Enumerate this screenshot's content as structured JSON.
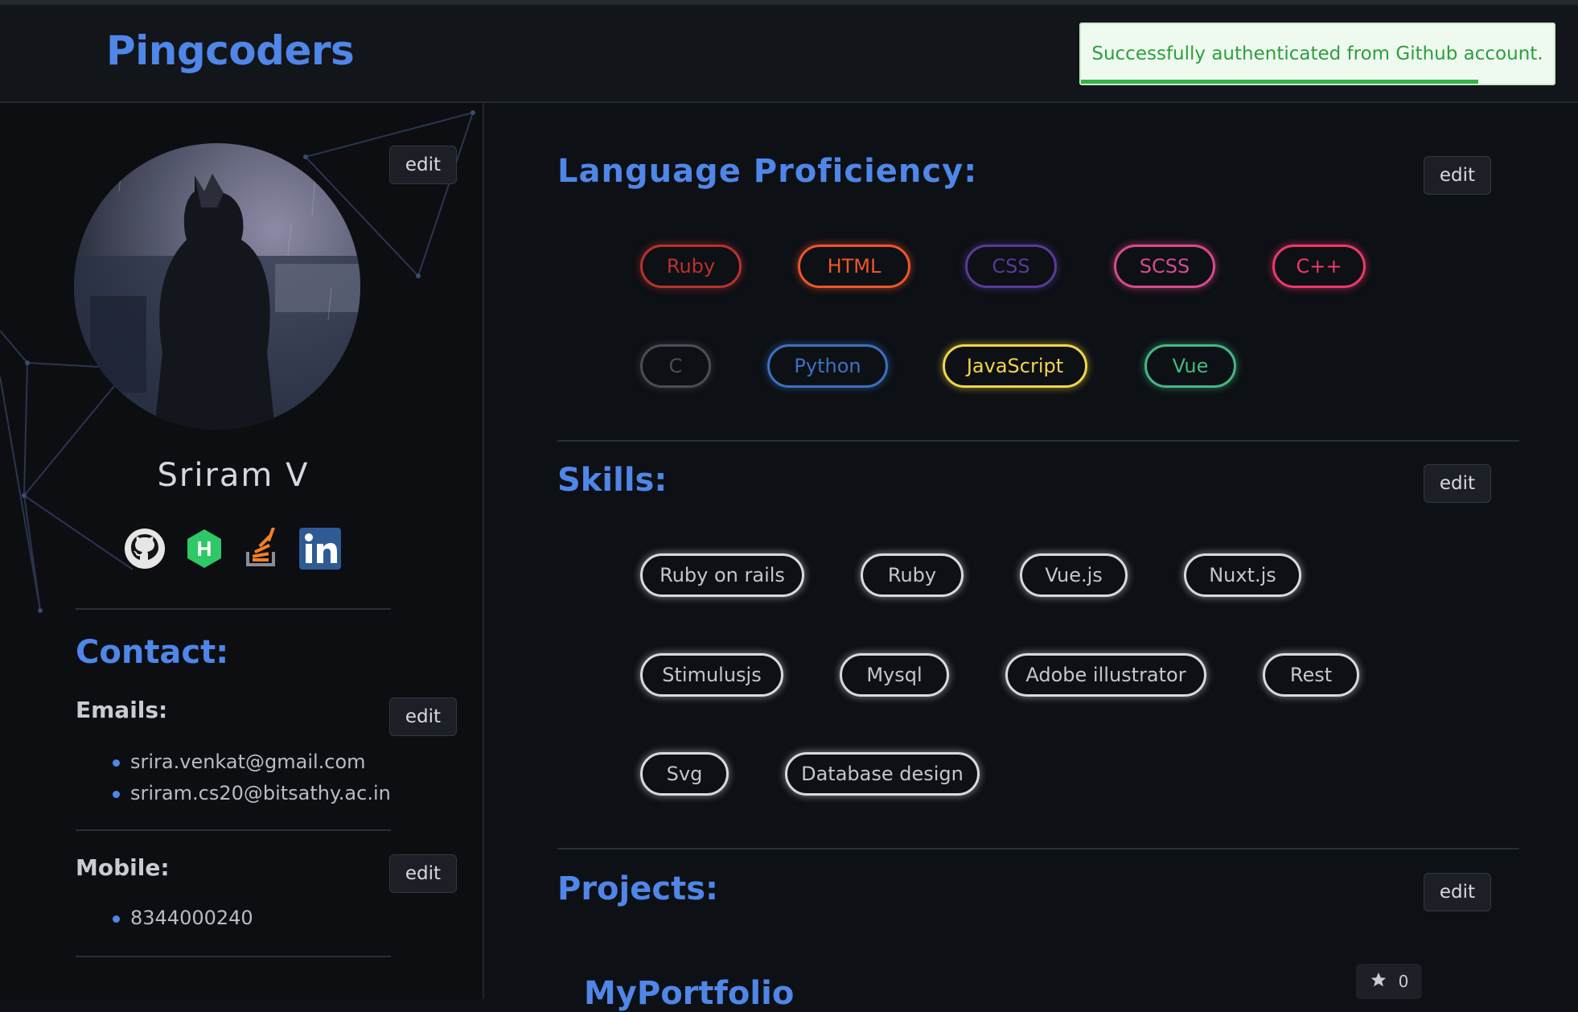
{
  "header": {
    "brand": "Pingcoders",
    "toast": "Successfully authenticated from Github account."
  },
  "profile": {
    "name": "Sriram V",
    "edit_label": "edit",
    "social": [
      "github-icon",
      "hackerrank-icon",
      "stackoverflow-icon",
      "linkedin-icon"
    ]
  },
  "contact": {
    "title": "Contact:",
    "emails_label": "Emails:",
    "emails": [
      "srira.venkat@gmail.com",
      "sriram.cs20@bitsathy.ac.in"
    ],
    "mobile_label": "Mobile:",
    "mobiles": [
      "8344000240"
    ],
    "edit_label": "edit"
  },
  "languages": {
    "title": "Language Proficiency:",
    "edit_label": "edit",
    "items": [
      {
        "label": "Ruby",
        "color": "#b8322e"
      },
      {
        "label": "HTML",
        "color": "#f0552a"
      },
      {
        "label": "CSS",
        "color": "#5a3a9a"
      },
      {
        "label": "SCSS",
        "color": "#d94a8f"
      },
      {
        "label": "C++",
        "color": "#f0386a"
      },
      {
        "label": "C",
        "color": "#4a4d55"
      },
      {
        "label": "Python",
        "color": "#3a72c2"
      },
      {
        "label": "JavaScript",
        "color": "#f2d54a"
      },
      {
        "label": "Vue",
        "color": "#44b883"
      }
    ]
  },
  "skills": {
    "title": "Skills:",
    "edit_label": "edit",
    "items": [
      "Ruby on rails",
      "Ruby",
      "Vue.js",
      "Nuxt.js",
      "Stimulusjs",
      "Mysql",
      "Adobe illustrator",
      "Rest",
      "Svg",
      "Database design"
    ]
  },
  "projects": {
    "title": "Projects:",
    "edit_label": "edit",
    "first_project": "MyPortfolio",
    "stars": "0"
  }
}
